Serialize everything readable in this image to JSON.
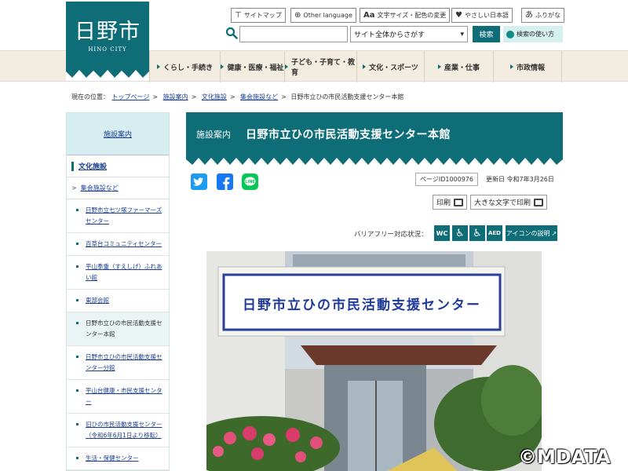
{
  "header": {
    "logo_jp": "日野市",
    "logo_en": "HINO CITY",
    "util_links": [
      {
        "label": "サイトマップ",
        "icon": "sitemap-icon"
      },
      {
        "label": "Other language",
        "icon": "globe-icon"
      },
      {
        "label": "文字サイズ・配色の変更",
        "icon": "text-size-icon"
      },
      {
        "label": "やさしい日本語",
        "icon": "heart-icon"
      },
      {
        "label": "ふりがな",
        "icon": "furigana-icon"
      }
    ],
    "search": {
      "placeholder": "",
      "scope": "サイト全体からさがす",
      "button": "検索",
      "howto": "検索の使い方"
    },
    "nav": [
      "くらし・手続き",
      "健康・医療・福祉",
      "子ども・子育て・教育",
      "文化・スポーツ",
      "産業・仕事",
      "市政情報"
    ]
  },
  "breadcrumb": {
    "prefix": "現在の位置：",
    "links": [
      "トップページ",
      "施設案内",
      "文化施設",
      "集会施設など"
    ],
    "current": "日野市立ひの市民活動支援センター本館"
  },
  "sidebar": {
    "heading": "施設案内",
    "category": "文化施設",
    "subcategory": "集会施設など",
    "items": [
      "日野市立七ツ塚ファーマーズセンター",
      "百草台コミュニティセンター",
      "平山季重（すえしげ）ふれあい館",
      "東部会館",
      "日野市立ひの市民活動支援センター本館",
      "日野市立ひの市民活動支援センター分館",
      "平山台健康・市民支援センター",
      "旧ひの市民活動支援センター（令和6年6月1日より移転）",
      "生活・保健センター"
    ]
  },
  "main": {
    "category": "施設案内",
    "title": "日野市立ひの市民活動支援センター本館",
    "page_id": "ページID1000976",
    "updated": "更新日 令和7年3月26日",
    "print": "印刷",
    "print_large": "大きな文字で印刷",
    "barrier_free_label": "バリアフリー対応状況：",
    "barrier_icons": [
      "WC",
      "♿",
      "♿",
      "AED"
    ],
    "icon_explain": "アイコンの説明",
    "photo_sign": "日野市立ひの市民活動支援センター"
  },
  "watermark": "©MDATA",
  "colors": {
    "brand": "#0f6d78",
    "nav_bg": "#f3ece0",
    "link": "#1a3d8f"
  }
}
